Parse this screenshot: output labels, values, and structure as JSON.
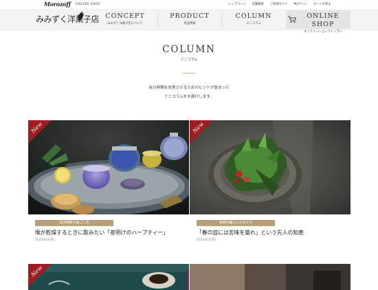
{
  "header": {
    "brand": "Morozoff",
    "brand_sub": "ONLINE SHOP",
    "utility_links": [
      "トップページ",
      "店舗検索",
      "ご利用ガイド",
      "Myページ",
      "カートを見る"
    ]
  },
  "nav": {
    "logo_text": "みみずく洋菓子店",
    "items": [
      {
        "en": "CONCEPT",
        "jp": "みみずく洋菓子店について"
      },
      {
        "en": "PRODUCT",
        "jp": "商品情報"
      },
      {
        "en": "COLUMN",
        "jp": "ミニコラム"
      },
      {
        "en": "ONLINE SHOP",
        "jp": "オンラインショップトップへ"
      }
    ]
  },
  "page": {
    "title": "COLUMN",
    "subtitle": "ミニコラム",
    "intro_line1": "自分時間を充実させるためのヒントが詰まった",
    "intro_line2": "ミニコラムをお届けします。"
  },
  "cards": [
    {
      "ribbon": "New",
      "tag": "自分時間の過ごし方",
      "title": "喉が乾燥するときに飲みたい「夜明けのハーブティー」",
      "date": "2023/4/3(月)"
    },
    {
      "ribbon": "New",
      "tag": "季節の暮らしかたメモ",
      "title": "「春の皿には苦味を盛れ」という先人の知恵",
      "date": "2023/4/3(月)"
    },
    {
      "ribbon": "New"
    },
    {}
  ],
  "colors": {
    "ribbon": "#a01c22",
    "tag": "#b9a07a",
    "accent_rule": "#c9ae7c",
    "nav_bg": "#f3f3f3"
  }
}
